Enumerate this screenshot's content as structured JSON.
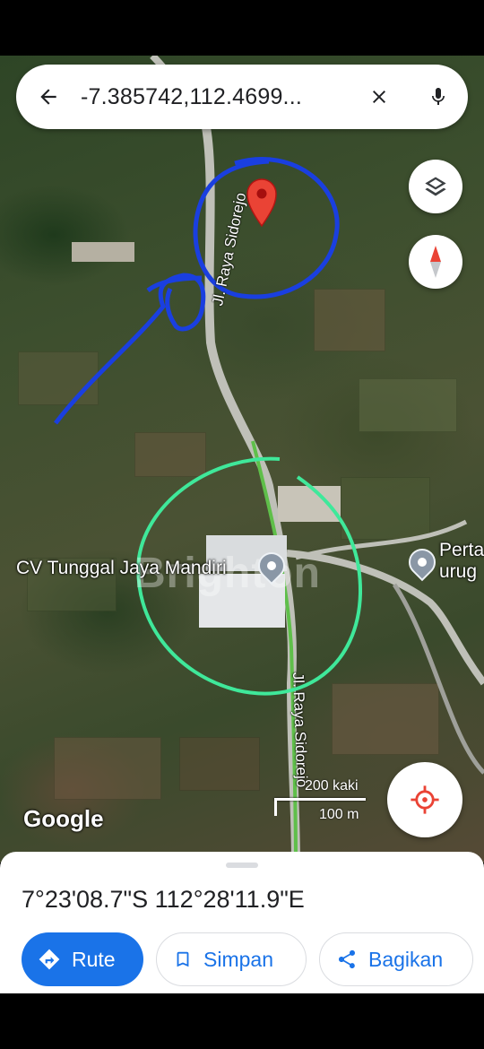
{
  "search": {
    "query": "-7.385742,112.4699...",
    "back_icon": "arrow-left-icon",
    "clear_icon": "close-icon",
    "mic_icon": "mic-icon"
  },
  "map": {
    "controls": {
      "layers_icon": "layers-icon",
      "compass_icon": "compass-icon",
      "locate_icon": "my-location-icon"
    },
    "road_labels": [
      "Jl. Raya Sidorejo",
      "Jl. Raya Sidorejo"
    ],
    "places": [
      {
        "name": "CV Tunggal Jaya Mandiri"
      },
      {
        "name": "Perta urug"
      }
    ],
    "place_name_lines": [
      "Perta",
      "urug"
    ],
    "watermark": "Brighton",
    "logo": "Google",
    "scale": {
      "imperial": "200 kaki",
      "metric": "100 m"
    },
    "colors": {
      "pin": "#ea4335",
      "blue_annotation": "#1a3fe0",
      "green_annotation": "#3fe89a"
    }
  },
  "sheet": {
    "coordinates": "7°23'08.7\"S 112°28'11.9\"E",
    "actions": {
      "route_label": "Rute",
      "save_label": "Simpan",
      "share_label": "Bagikan"
    },
    "accent": "#1a73e8"
  }
}
